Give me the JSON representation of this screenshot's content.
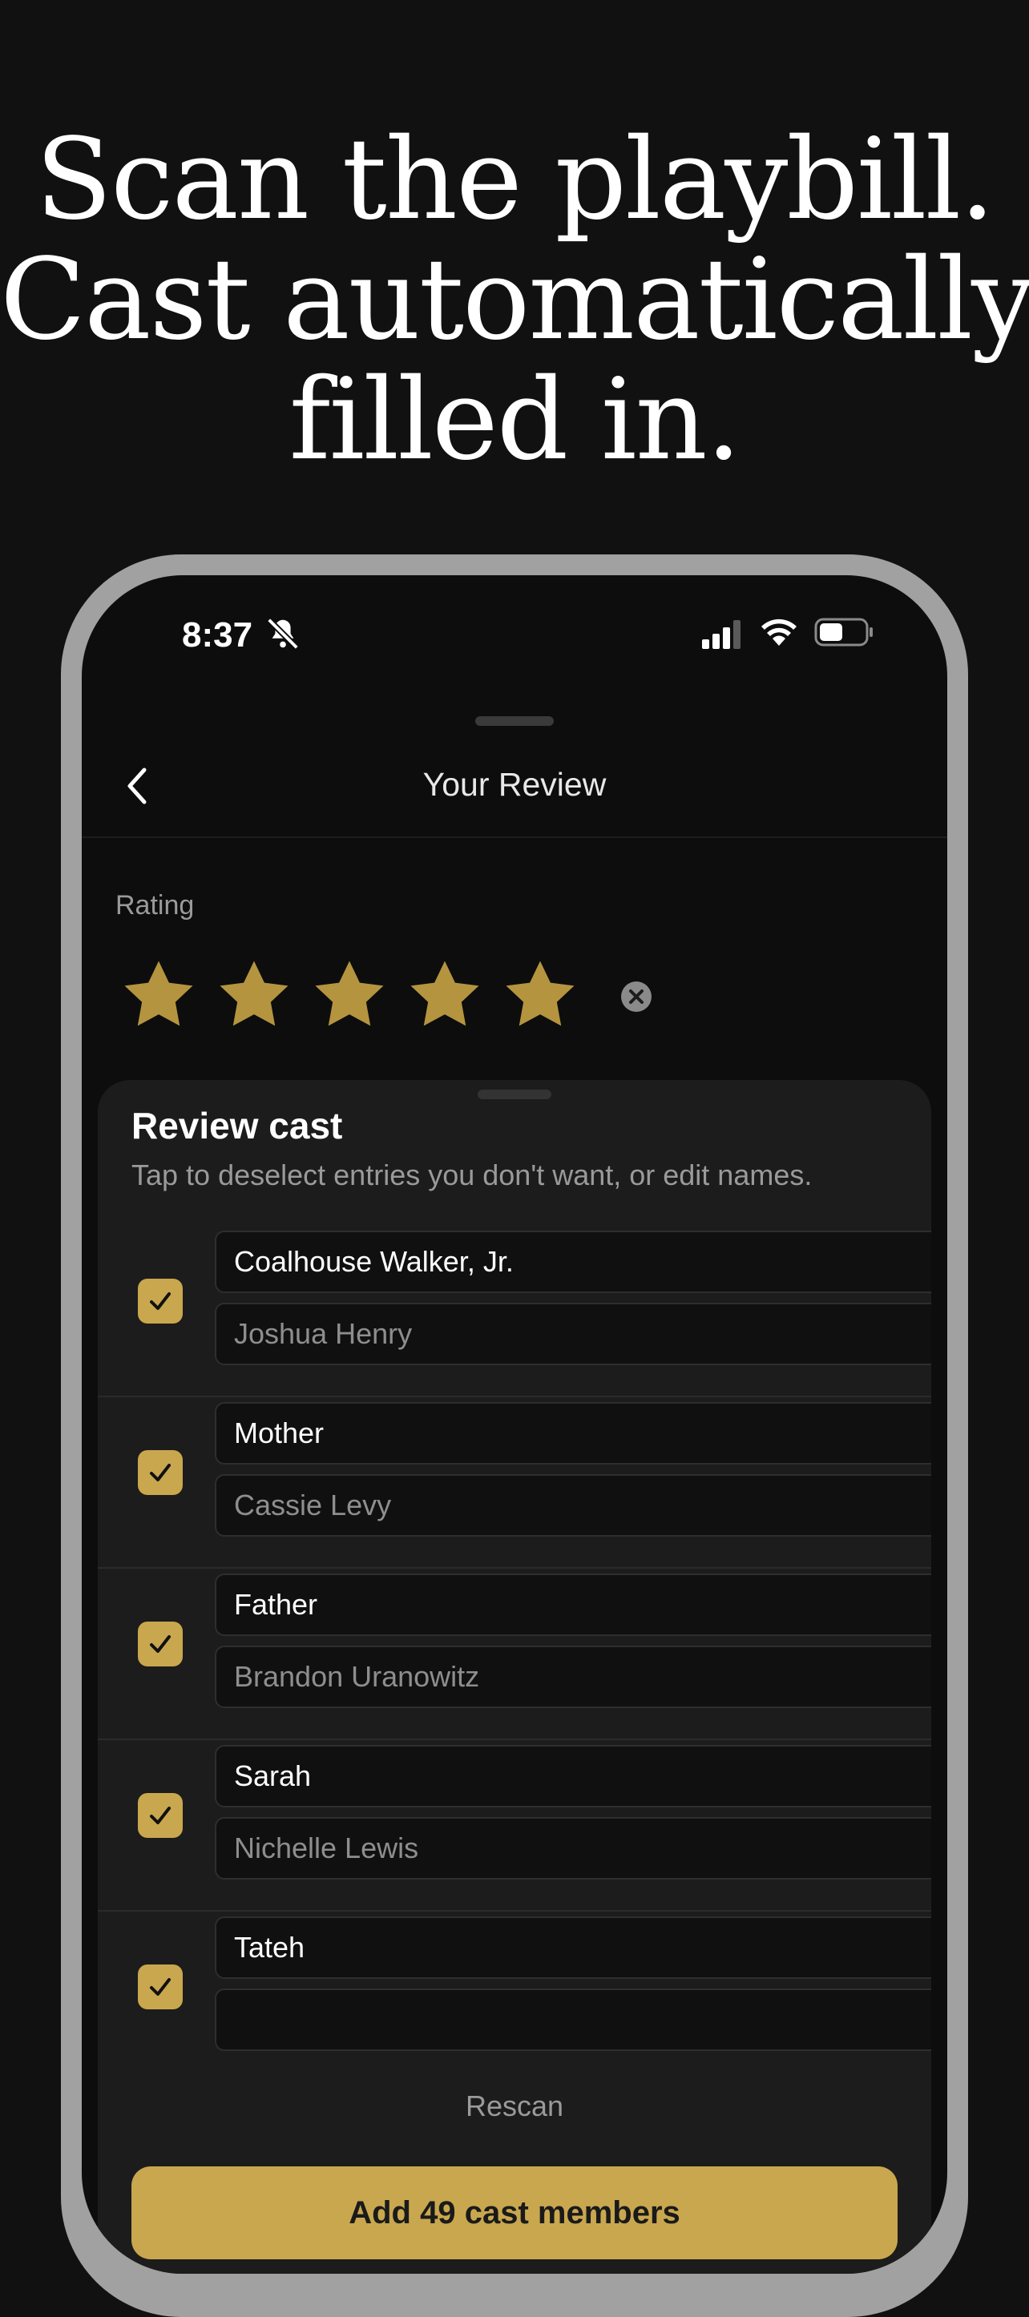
{
  "headline": {
    "line1": "Scan the playbill.",
    "line2": "Cast automatically",
    "line3": "filled in."
  },
  "status_bar": {
    "time": "8:37",
    "icons": [
      "bell-slash-icon",
      "cellular-signal-icon",
      "wifi-icon",
      "battery-icon"
    ]
  },
  "nav": {
    "title": "Your Review",
    "back_icon": "chevron-left-icon"
  },
  "rating": {
    "label": "Rating",
    "stars": 5,
    "max_stars": 5,
    "clear_icon": "x-circle-icon"
  },
  "sheet": {
    "title": "Review cast",
    "subtitle": "Tap to deselect entries you don't want, or edit names.",
    "rows": [
      {
        "role": "Coalhouse Walker, Jr.",
        "actor": "Joshua Henry",
        "checked": true
      },
      {
        "role": "Mother",
        "actor": "Cassie Levy",
        "checked": true
      },
      {
        "role": "Father",
        "actor": "Brandon Uranowitz",
        "checked": true
      },
      {
        "role": "Sarah",
        "actor": "Nichelle Lewis",
        "checked": true
      },
      {
        "role": "Tateh",
        "actor": "",
        "checked": true
      }
    ],
    "rescan_label": "Rescan",
    "add_button_label": "Add 49 cast members"
  },
  "colors": {
    "background": "#111111",
    "accent_gold": "#c9a74e",
    "sheet": "#1c1c1c",
    "field": "#101010"
  }
}
